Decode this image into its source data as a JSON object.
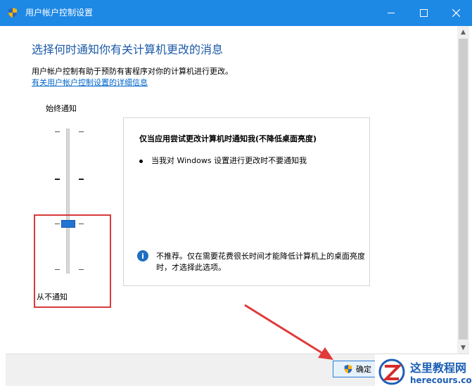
{
  "window": {
    "title": "用户帐户控制设置"
  },
  "main": {
    "heading": "选择何时通知你有关计算机更改的消息",
    "description": "用户帐户控制有助于预防有害程序对你的计算机进行更改。",
    "link": "有关用户帐户控制设置的详细信息"
  },
  "slider": {
    "top_label": "始终通知",
    "bottom_label": "从不通知",
    "levels": 4,
    "selected_level": 2
  },
  "panel": {
    "title": "仅当应用尝试更改计算机时通知我(不降低桌面亮度)",
    "bullet": "当我对 Windows 设置进行更改时不要通知我",
    "note": "不推荐。仅在需要花费很长时间才能降低计算机上的桌面亮度时，才选择此选项。"
  },
  "footer": {
    "ok_label": "确定"
  },
  "watermark": {
    "title": "这里教程网",
    "domain": "herecours.com"
  },
  "colors": {
    "titlebar": "#1e88e5",
    "heading": "#1b5aa7",
    "link": "#0066cc",
    "slider_thumb": "#1f74d4",
    "highlight_box": "#d9393a"
  },
  "icons": {
    "title": "uac-shield-icon",
    "minimize": "minimize-icon",
    "maximize": "maximize-icon",
    "close": "close-icon",
    "info": "info-icon",
    "ok": "uac-shield-icon"
  }
}
